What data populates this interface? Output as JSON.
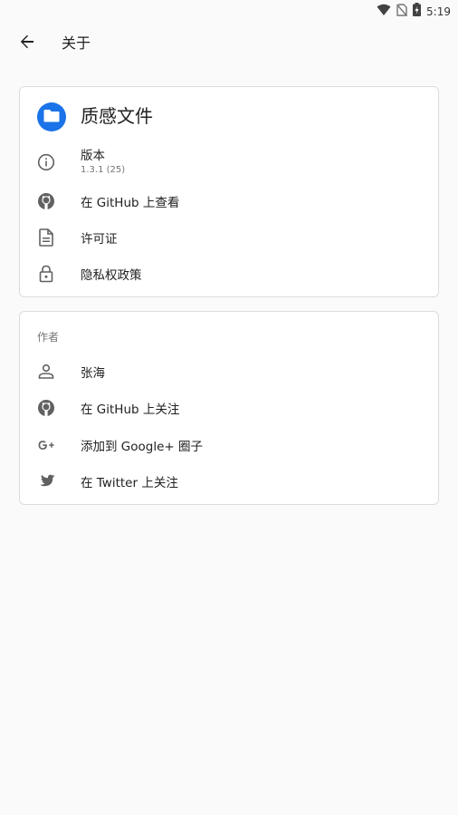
{
  "status_bar": {
    "time": "5:19",
    "icons": [
      "wifi-icon",
      "no-sim-icon",
      "battery-charging-icon"
    ]
  },
  "app_bar": {
    "title": "关于",
    "back_icon": "arrow-back-icon"
  },
  "about_card": {
    "app_name": "质感文件",
    "logo_icon": "folder-icon",
    "logo_color": "#1a73e8",
    "version": {
      "label": "版本",
      "value": "1.3.1 (25)",
      "icon": "info-icon"
    },
    "items": [
      {
        "label": "在 GitHub 上查看",
        "icon": "github-icon"
      },
      {
        "label": "许可证",
        "icon": "document-icon"
      },
      {
        "label": "隐私权政策",
        "icon": "lock-icon"
      }
    ]
  },
  "author_card": {
    "title": "作者",
    "items": [
      {
        "label": "张海",
        "icon": "person-icon"
      },
      {
        "label": "在 GitHub 上关注",
        "icon": "github-icon"
      },
      {
        "label": "添加到 Google+ 圈子",
        "icon": "google-plus-icon"
      },
      {
        "label": "在 Twitter 上关注",
        "icon": "twitter-icon"
      }
    ]
  }
}
